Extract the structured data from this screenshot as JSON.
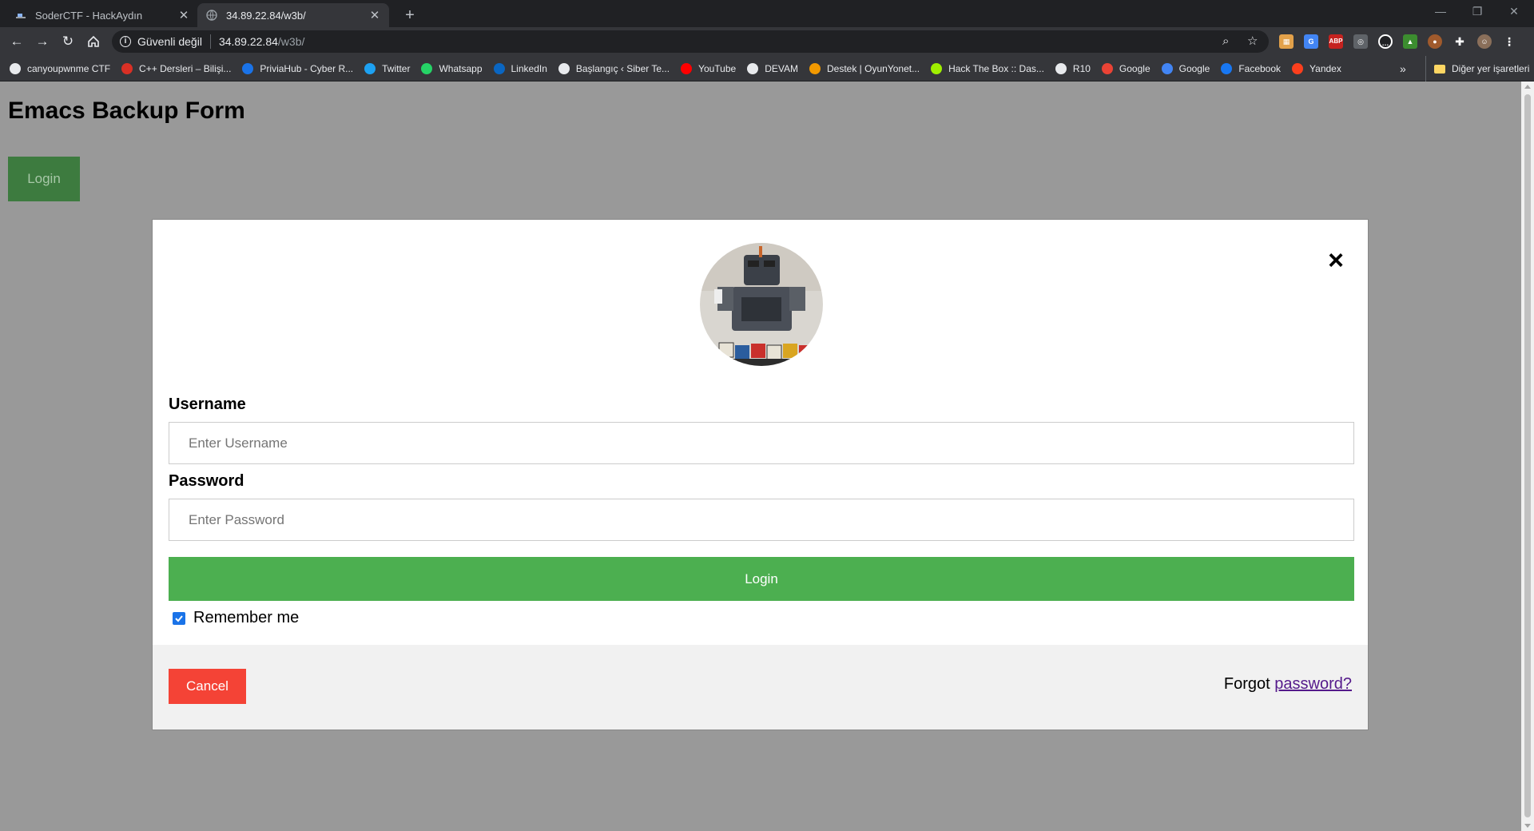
{
  "browser": {
    "tabs": [
      {
        "title": "SoderCTF - HackAydın",
        "active": false
      },
      {
        "title": "34.89.22.84/w3b/",
        "active": true
      }
    ],
    "address": {
      "security_label": "Güvenli değil",
      "host": "34.89.22.84",
      "path": "/w3b/"
    },
    "bookmarks": [
      {
        "label": "canyoupwnme CTF",
        "icon": "globe-icon",
        "color": "#e8eaed"
      },
      {
        "label": "C++ Dersleri – Bilişi...",
        "icon": "site-icon",
        "color": "#d93025"
      },
      {
        "label": "PriviaHub - Cyber R...",
        "icon": "priviahub-icon",
        "color": "#1a73e8"
      },
      {
        "label": "Twitter",
        "icon": "twitter-icon",
        "color": "#1da1f2"
      },
      {
        "label": "Whatsapp",
        "icon": "whatsapp-icon",
        "color": "#25d366"
      },
      {
        "label": "LinkedIn",
        "icon": "linkedin-icon",
        "color": "#0a66c2"
      },
      {
        "label": "Başlangıç ‹ Siber Te...",
        "icon": "globe-icon",
        "color": "#e8eaed"
      },
      {
        "label": "YouTube",
        "icon": "youtube-icon",
        "color": "#ff0000"
      },
      {
        "label": "DEVAM",
        "icon": "globe-icon",
        "color": "#e8eaed"
      },
      {
        "label": "Destek | OyunYonet...",
        "icon": "m-icon",
        "color": "#f29900"
      },
      {
        "label": "Hack The Box :: Das...",
        "icon": "htb-icon",
        "color": "#9fef00"
      },
      {
        "label": "R10",
        "icon": "r10-icon",
        "color": "#e8eaed"
      },
      {
        "label": "Google",
        "icon": "gmail-icon",
        "color": "#ea4335"
      },
      {
        "label": "Google",
        "icon": "google-icon",
        "color": "#4285f4"
      },
      {
        "label": "Facebook",
        "icon": "facebook-icon",
        "color": "#1877f2"
      },
      {
        "label": "Yandex",
        "icon": "yandex-icon",
        "color": "#fc3f1d"
      }
    ],
    "bookmarks_more": "»",
    "other_bookmarks": "Diğer yer işaretleri"
  },
  "page": {
    "title": "Emacs Backup Form",
    "open_login_label": "Login"
  },
  "modal": {
    "close_symbol": "×",
    "username_label": "Username",
    "username_placeholder": "Enter Username",
    "password_label": "Password",
    "password_placeholder": "Enter Password",
    "submit_label": "Login",
    "remember_label": "Remember me",
    "remember_checked": true,
    "cancel_label": "Cancel",
    "forgot_text": "Forgot",
    "forgot_link": "password?"
  },
  "colors": {
    "overlay": "#999999",
    "submit_green": "#4caf50",
    "cancel_red": "#f44336",
    "open_login_green": "#3d7b3f",
    "link_purple": "#551a8b"
  }
}
